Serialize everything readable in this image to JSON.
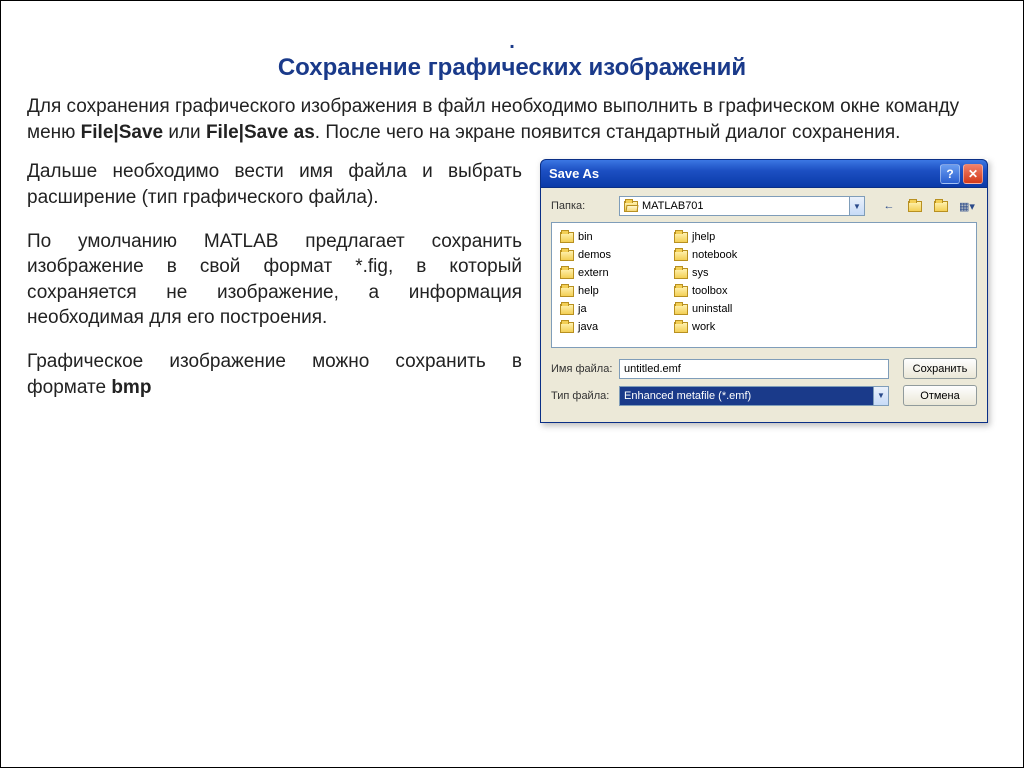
{
  "title": "Сохранение графических изображений",
  "intro_prefix": "Для сохранения графического изображения в файл необходимо выполнить в графическом окне команду меню ",
  "intro_bold1": "File|Save",
  "intro_mid": " или ",
  "intro_bold2": "File|Save as",
  "intro_suffix": ". После чего на экране появится стандартный диалог сохранения.",
  "para1": "Дальше необходимо вести имя файла и выбрать расширение (тип графического файла).",
  "para2": "По умолчанию MATLAB предлагает сохранить изображение в свой формат *.fig, в который сохраняется не изображение, а информация необходимая для его построения.",
  "para3_prefix": "Графическое изображение можно сохранить в формате ",
  "para3_bold": "bmp",
  "dialog": {
    "title": "Save As",
    "folder_label": "Папка:",
    "folder_value": "MATLAB701",
    "filename_label": "Имя файла:",
    "filename_value": "untitled.emf",
    "filetype_label": "Тип файла:",
    "filetype_value": "Enhanced metafile (*.emf)",
    "save_button": "Сохранить",
    "cancel_button": "Отмена",
    "items_col1": [
      "bin",
      "demos",
      "extern",
      "help",
      "ja",
      "java"
    ],
    "items_col2": [
      "jhelp",
      "notebook",
      "sys",
      "toolbox",
      "uninstall",
      "work"
    ]
  }
}
